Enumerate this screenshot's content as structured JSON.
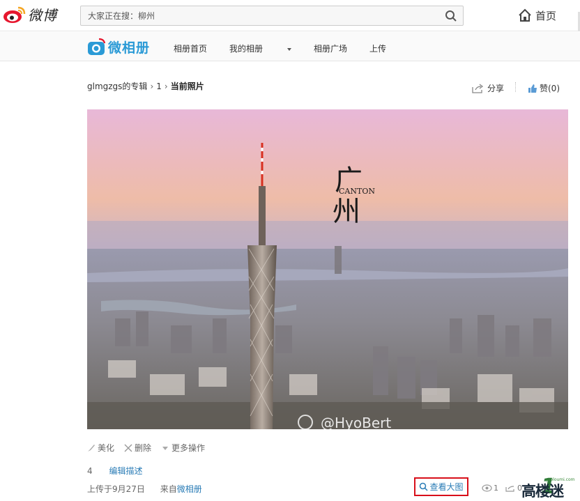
{
  "topbar": {
    "brand": "微博",
    "search_placeholder": "大家正在搜：柳州",
    "home_label": "首页"
  },
  "subnav": {
    "album_brand": "微相册",
    "links": [
      "相册首页",
      "我的相册",
      "相册广场",
      "上传"
    ]
  },
  "breadcrumb": {
    "album": "glmgzgs的专辑",
    "page": "1",
    "current": "当前照片"
  },
  "actions": {
    "share_label": "分享",
    "like_label": "赞(0)"
  },
  "photo": {
    "title_line1": "广",
    "title_line2": "州",
    "caption": "CANTON",
    "watermark": "@HyoBert"
  },
  "tools": {
    "beautify": "美化",
    "delete": "删除",
    "more": "更多操作"
  },
  "description": {
    "text": "4",
    "edit_label": "编辑描述"
  },
  "meta": {
    "uploaded": "上传于9月27日",
    "from_prefix": "来自",
    "from_app": "微相册"
  },
  "view_large_label": "查看大图",
  "stats": {
    "views": "1",
    "shares": "0"
  },
  "site_watermark": {
    "text": "高楼迷",
    "small": "gaoloumi.com",
    "number": "1"
  },
  "colors": {
    "link": "#2a7cb6",
    "album_brand": "#2a9ad6",
    "highlight_box": "#d80f1a"
  }
}
